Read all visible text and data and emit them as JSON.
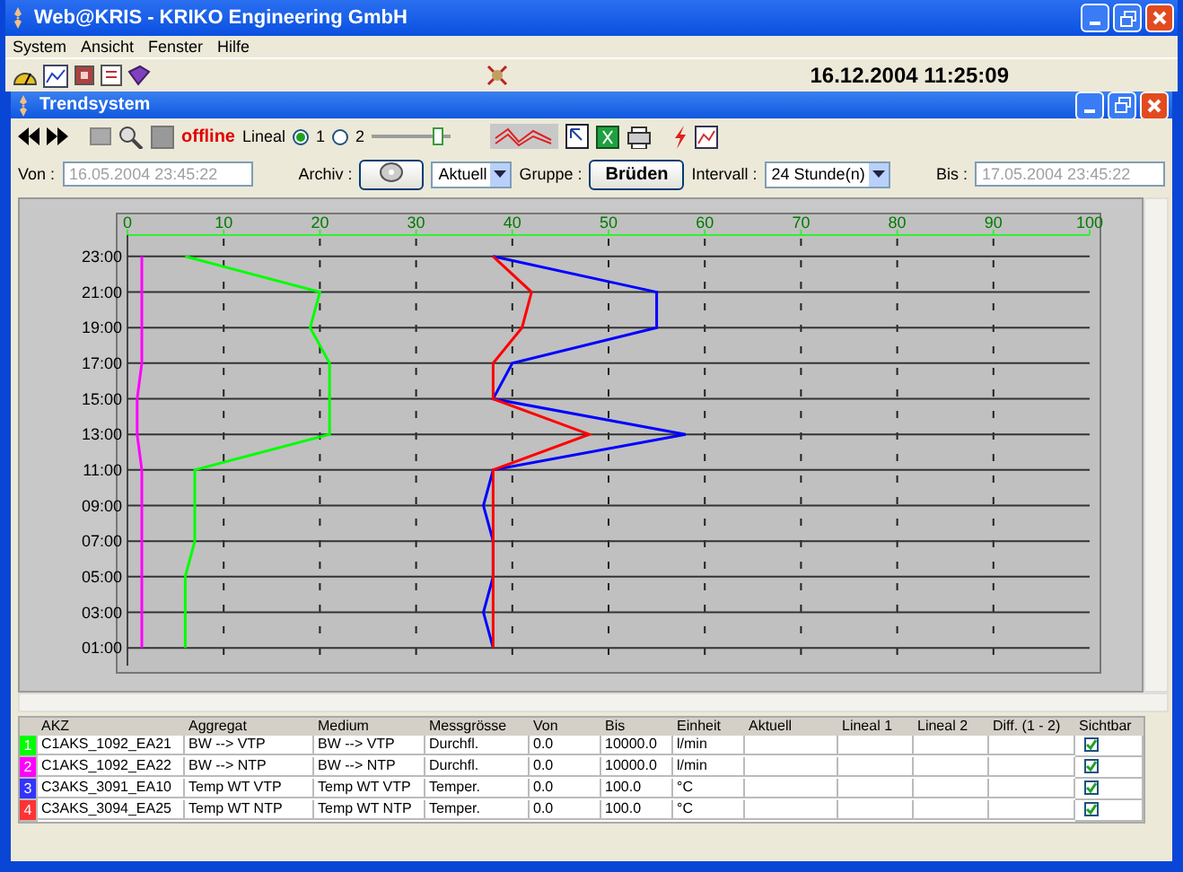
{
  "window": {
    "title": "Web@KRIS - KRIKO Engineering GmbH"
  },
  "menu": [
    "System",
    "Ansicht",
    "Fenster",
    "Hilfe"
  ],
  "toolbar": {
    "datetime": "16.12.2004 11:25:09"
  },
  "trend_window": {
    "title": "Trendsystem"
  },
  "trend_toolbar": {
    "status": "offline",
    "ruler_label": "Lineal",
    "rulers": [
      {
        "label": "1",
        "selected": true
      },
      {
        "label": "2",
        "selected": false
      }
    ],
    "slider": {
      "level": 0.85
    }
  },
  "filter": {
    "from_label": "Von :",
    "from": "16.05.2004 23:45:22",
    "archive_label": "Archiv :",
    "archive": "Aktuell",
    "group_label": "Gruppe :",
    "group_button": "Brüden",
    "interval_label": "Intervall :",
    "interval": "24 Stunde(n)",
    "to_label": "Bis :",
    "to": "17.05.2004 23:45:22"
  },
  "chart": {
    "chart_data": {
      "type": "line",
      "orientation": "horizontal",
      "grid": true,
      "categories": [
        "23:00",
        "21:00",
        "19:00",
        "17:00",
        "15:00",
        "13:00",
        "11:00",
        "09:00",
        "07:00",
        "05:00",
        "03:00",
        "01:00"
      ],
      "xlim": [
        0,
        100
      ],
      "xticks": [
        0,
        10,
        20,
        30,
        40,
        50,
        60,
        70,
        80,
        90,
        100
      ],
      "series": [
        {
          "color": "#00ff00",
          "values": [
            6,
            20,
            19,
            21,
            21,
            21,
            7,
            7,
            7,
            6,
            6,
            6
          ]
        },
        {
          "color": "#ff00ff",
          "values": [
            1.5,
            1.5,
            1.5,
            1.5,
            1,
            1,
            1.5,
            1.5,
            1.5,
            1.5,
            1.5,
            1.5
          ]
        },
        {
          "color": "#0000ff",
          "values": [
            38,
            55,
            55,
            40,
            38,
            58,
            38,
            37,
            38,
            38,
            37,
            38
          ]
        },
        {
          "color": "#ff0000",
          "values": [
            38,
            42,
            41,
            38,
            38,
            48,
            38,
            38,
            38,
            38,
            38,
            38
          ]
        }
      ]
    }
  },
  "table": {
    "columns": [
      "AKZ",
      "Aggregat",
      "Medium",
      "Messgrösse",
      "Von",
      "Bis",
      "Einheit",
      "Aktuell",
      "Lineal 1",
      "Lineal 2",
      "Diff. (1 - 2)",
      "Sichtbar"
    ],
    "rows": [
      {
        "index": "1",
        "color": "#00ff00",
        "cells": [
          "C1AKS_1092_EA21",
          "BW --> VTP",
          "BW --> VTP",
          "Durchfl.",
          "0.0",
          "10000.0",
          "l/min",
          "",
          "",
          "",
          ""
        ],
        "visible": true
      },
      {
        "index": "2",
        "color": "#ff00ff",
        "cells": [
          "C1AKS_1092_EA22",
          "BW --> NTP",
          "BW --> NTP",
          "Durchfl.",
          "0.0",
          "10000.0",
          "l/min",
          "",
          "",
          "",
          ""
        ],
        "visible": true
      },
      {
        "index": "3",
        "color": "#3333ff",
        "cells": [
          "C3AKS_3091_EA10",
          "Temp WT VTP",
          "Temp WT VTP",
          "Temper.",
          "0.0",
          "100.0",
          "°C",
          "",
          "",
          "",
          ""
        ],
        "visible": true
      },
      {
        "index": "4",
        "color": "#ff3333",
        "cells": [
          "C3AKS_3094_EA25",
          "Temp WT NTP",
          "Temp WT NTP",
          "Temper.",
          "0.0",
          "100.0",
          "°C",
          "",
          "",
          "",
          ""
        ],
        "visible": true
      }
    ]
  }
}
